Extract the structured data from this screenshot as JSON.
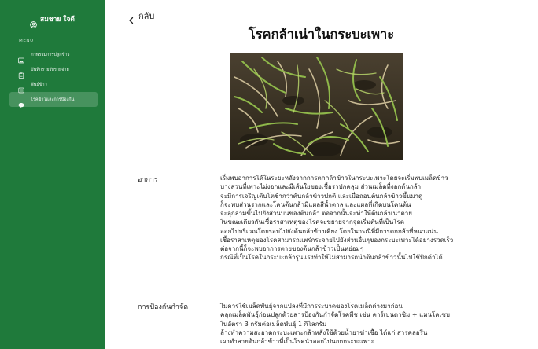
{
  "sidebar": {
    "user": {
      "icon": "user-circle-icon",
      "name": "สมชาย ใจดี"
    },
    "menu_label": "MENU",
    "items": [
      {
        "label": "ภาพรวมการปลูกข้าว",
        "icon": "image-icon",
        "active": false
      },
      {
        "label": "บันทึกรายรับรายจ่าย",
        "icon": "clipboard-icon",
        "active": false
      },
      {
        "label": "พันธุ์ข้าว",
        "icon": "list-icon",
        "active": false
      },
      {
        "label": "โรคข้าวและการป้องกัน",
        "icon": "chat-bubble-icon",
        "active": true
      }
    ],
    "colors": {
      "background": "#1f7a3b",
      "active_item": "rgba(255,255,255,0.18)"
    }
  },
  "main": {
    "back_label": "กลับ",
    "title": "โรคกล้าเน่าในกระบะเพาะ",
    "symptoms": {
      "label": "อาการ",
      "lines": [
        "เริ่มพบอาการได้ในระยะหลังจากการตกกล้าข้าวในกระบะเพาะโดยจะเริ่มพบเมล็ดข้าว",
        "บางส่วนที่เพาะไม่งอกและมีเส้นใยของเชื้อราปกคลุม ส่วนเมล็ดที่งอกต้นกล้า",
        "จะมีการเจริญเติบโตช้ากว่าต้นกล้าข้าวปกติ และเมื่อถอนต้นกล้าข้าวขึ้นมาดู",
        "ก็จะพบส่วนรากและโคนต้นกล้ามีแผลสีน้ำตาล และแผลที่เกิดบนโคนต้น",
        "จะลุกลามขึ้นไปยังส่วนบนของต้นกล้า ต่อจากนั้นจะทำให้ต้นกล้าเน่าตาย",
        "ในขณะเดียวกันเชื้อราสาเหตุของโรคจะขยายจากจุดเริ่มต้นที่เป็นโรค",
        "ออกไปบริเวณโดยรอบไปยังต้นกล้าข้างเคียง โดยในกรณีที่มีการตกกล้าที่หนาแน่น",
        "เชื้อราสาเหตุของโรคสามารถแพร่กระจายไปยังส่วนอื่นๆของกระบะเพาะได้อย่างรวดเร็ว",
        "ต่อจากนี้ก็จะพบอาการตายของต้นกล้าข้าวเป็นหย่อมๆ",
        "กรณีที่เป็นโรคในกระบะกล้ารุนแรงทำให้ไม่สามารถนำต้นกล้าข้าวนั้นไปใช้ปักดำได้"
      ]
    },
    "prevention": {
      "label": "การป้องกันกำจัด",
      "lines": [
        "ไม่ควรใช้เมล็ดพันธุ์จากแปลงที่มีการระบาดของโรคเมล็ดด่างมาก่อน",
        "คลุกเมล็ดพันธุ์ก่อนปลูกด้วยสารป้องกันกำจัดโรคพืช เช่น คาร์เบนดาซิม + แมนโคเซบ",
        "ในอัตรา 3 กรัมต่อเมล็ดพันธุ์ 1 กิโลกรัม",
        "ล้างทำความสะอาดกระบะเพาะกล้าหลังใช้ด้วยน้ำยาฆ่าเชื้อ ได้แก่ สารคลอรีน",
        "เผาทำลายต้นกล้าข้าวที่เป็นโรคนำออกไปนอกกระบะเพาะ"
      ]
    }
  }
}
